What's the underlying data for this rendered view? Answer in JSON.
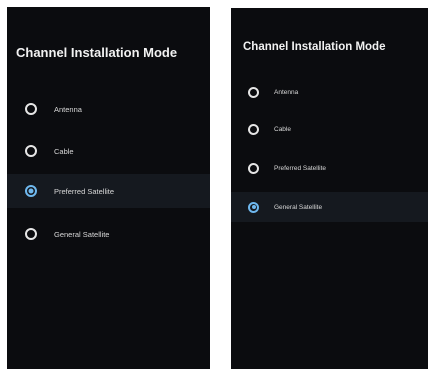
{
  "screens": [
    {
      "title": "Channel Installation Mode",
      "options": [
        {
          "label": "Antenna",
          "selected": false
        },
        {
          "label": "Cable",
          "selected": false
        },
        {
          "label": "Preferred Satellite",
          "selected": true
        },
        {
          "label": "General Satellite",
          "selected": false
        }
      ]
    },
    {
      "title": "Channel Installation Mode",
      "options": [
        {
          "label": "Antenna",
          "selected": false
        },
        {
          "label": "Cable",
          "selected": false
        },
        {
          "label": "Preferred Satellite",
          "selected": false
        },
        {
          "label": "General Satellite",
          "selected": true
        }
      ]
    }
  ],
  "colors": {
    "background": "#0b0c0f",
    "selected_row": "#15191f",
    "accent": "#6fb8ee",
    "text": "#f2f2f2"
  }
}
